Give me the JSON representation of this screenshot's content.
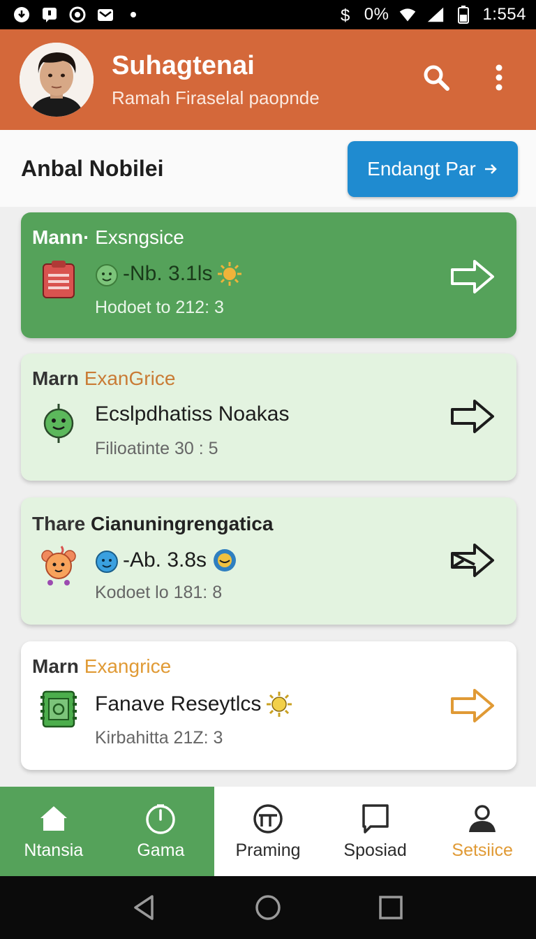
{
  "status_bar": {
    "battery_text": "0%",
    "time": "1:554"
  },
  "header": {
    "title": "Suhagtenai",
    "subtitle": "Ramah Firaselal paopnde"
  },
  "section": {
    "title": "Anbal Nobilei",
    "cta_label": "Endangt Par"
  },
  "cards": [
    {
      "eyebrow": "Mann·",
      "tag": "Exsngsice",
      "main": "-Nb. 3.1ls",
      "sub": "Hodoet to  212: 3"
    },
    {
      "eyebrow": "Marn",
      "tag": "ExanGrice",
      "main": "Ecslpdhatiss Noakas",
      "sub": "Filioatinte   30 : 5"
    },
    {
      "eyebrow": "Thare",
      "tag": "Cianuningrengatica",
      "main": "-Ab. 3.8s",
      "sub": "Kodoet lo  181: 8"
    },
    {
      "eyebrow": "Marn",
      "tag": "Exangrice",
      "main": "Fanave Reseytlcs",
      "sub": "Kirbahitta  21Z: 3"
    }
  ],
  "bottom_nav": [
    {
      "label": "Ntansia",
      "icon": "home-icon"
    },
    {
      "label": "Gama",
      "icon": "timer-icon"
    },
    {
      "label": "Praming",
      "icon": "planner-icon"
    },
    {
      "label": "Sposiad",
      "icon": "chat-icon"
    },
    {
      "label": "Setsiice",
      "icon": "person-icon"
    }
  ],
  "colors": {
    "header": "#d4683a",
    "primary_green": "#55a25a",
    "light_green": "#e3f3e0",
    "cta_blue": "#1f8bd0",
    "accent_orange": "#e09a35"
  }
}
